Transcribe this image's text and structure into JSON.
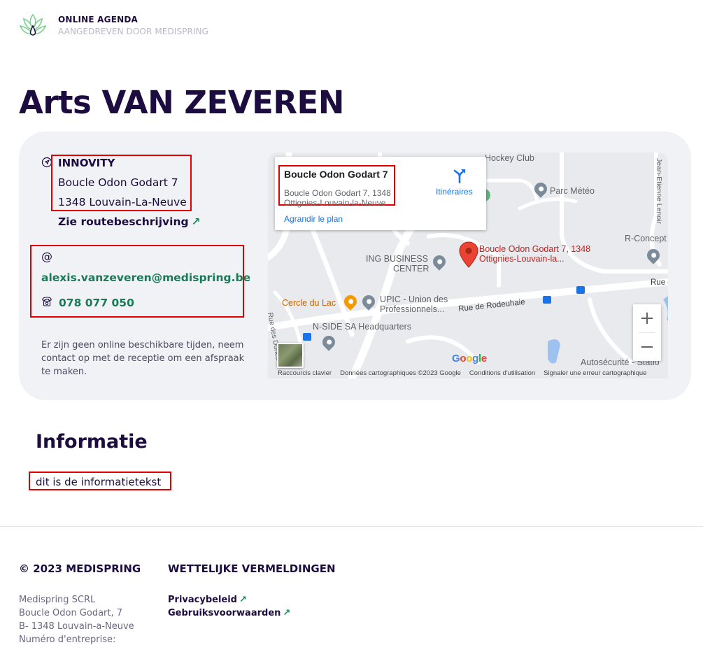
{
  "header": {
    "title": "ONLINE AGENDA",
    "subtitle": "AANGEDREVEN DOOR MEDISPRING",
    "logo_icon": "lotus-logo"
  },
  "page_title": "Arts VAN ZEVEREN",
  "location": {
    "name": "INNOVITY",
    "street": "Boucle Odon Godart 7",
    "city": "1348 Louvain-La-Neuve",
    "route_label": "Zie routebeschrijving",
    "route_arrow": "↗"
  },
  "contact": {
    "at_symbol": "@",
    "email": "alexis.vanzeveren@medispring.be",
    "phone": "078 077 050"
  },
  "notice": "Er zijn geen online beschikbare tijden, neem contact op met de receptie om een afspraak te maken.",
  "map": {
    "popup": {
      "title": "Boucle Odon Godart 7",
      "addr_line1": "Boucle Odon Godart 7, 1348",
      "addr_line2": "Ottignies-Louvain-la-Neuve",
      "enlarge": "Agrandir le plan",
      "directions": "Itinéraires"
    },
    "marker_label_line1": "Boucle Odon Godart 7, 1348",
    "marker_label_line2": "Ottignies-Louvain-la...",
    "labels": {
      "hockey": "Hockey Club",
      "parc": "Parc Météo",
      "rconcept": "R-Concept",
      "ing1": "ING BUSINESS",
      "ing2": "CENTER",
      "cercle": "Cercle du Lac",
      "upic1": "UPIC - Union des",
      "upic2": "Professionnels...",
      "rodeuhaie": "Rue de Rodeuhaie",
      "rue": "Rue d",
      "nside": "N-SIDE SA Headquarters",
      "auto": "Autosécurité - Statio",
      "lenoir": "Jean-Etienne Lenoir",
      "dunes": "Rue des Dunes"
    },
    "zoom_in": "+",
    "zoom_out": "−",
    "google": "Google",
    "footer": {
      "shortcuts": "Raccourcis clavier",
      "data": "Données cartographiques ©2023 Google",
      "terms": "Conditions d'utilisation",
      "report": "Signaler une erreur cartographique"
    }
  },
  "info": {
    "title": "Informatie",
    "text": "dit is de informatietekst"
  },
  "footer": {
    "copyright": "© 2023 MEDISPRING",
    "company": "Medispring SCRL",
    "street": "Boucle Odon Godart, 7",
    "city": "B- 1348 Louvain-a-Neuve",
    "enterprise": "Numéro d'entreprise:",
    "legal_title": "WETTELIJKE VERMELDINGEN",
    "privacy": "Privacybeleid",
    "terms": "Gebruiksvoorwaarden",
    "arrow": "↗"
  },
  "colors": {
    "brand_dark": "#1d0c3f",
    "accent_green": "#1a7a55",
    "highlight_red": "#e30000",
    "card_bg": "#f1f2f5"
  }
}
